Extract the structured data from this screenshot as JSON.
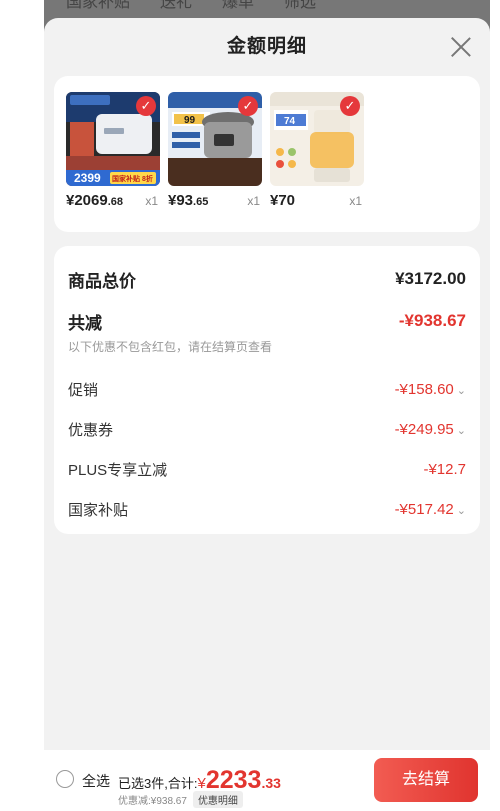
{
  "background": {
    "tabs": [
      "国家补贴",
      "送礼",
      "爆单",
      "筛选"
    ]
  },
  "sheet": {
    "title": "金额明细",
    "close_icon": "close-icon"
  },
  "products": [
    {
      "name": "water-heater",
      "price_int": "¥2069",
      "price_dec": ".68",
      "qty": "x1",
      "thumb_text": "2399",
      "thumb_tag": "国家补贴 8折",
      "colors": [
        "#1d3b6e",
        "#e9503c"
      ]
    },
    {
      "name": "electric-pressure-cooker",
      "price_int": "¥93",
      "price_dec": ".65",
      "qty": "x1",
      "thumb_text": "99",
      "thumb_tag": "",
      "colors": [
        "#2f5fa8",
        "#f2c24a"
      ]
    },
    {
      "name": "food-processor",
      "price_int": "¥70",
      "price_dec": "",
      "qty": "x1",
      "thumb_text": "74",
      "thumb_tag": "",
      "colors": [
        "#4d7bd4",
        "#f5b84a"
      ]
    }
  ],
  "summary": {
    "total_label": "商品总价",
    "total_value": "¥3172.00",
    "discount_label": "共减",
    "discount_value": "-¥938.67",
    "hint": "以下优惠不包含红包，请在结算页查看",
    "items": [
      {
        "label": "促销",
        "value": "-¥158.60",
        "chevron": true
      },
      {
        "label": "优惠券",
        "value": "-¥249.95",
        "chevron": true
      },
      {
        "label": "PLUS专享立减",
        "value": "-¥12.7",
        "chevron": false
      },
      {
        "label": "国家补贴",
        "value": "-¥517.42",
        "chevron": true
      }
    ]
  },
  "bottom": {
    "select_all": "全选",
    "selected_info": "已选3件,合计:",
    "total_currency": "¥",
    "total_int": "2233",
    "total_dec": ".33",
    "discount_text": "优惠减:¥938.67",
    "detail_button": "优惠明细",
    "checkout_button": "去结算"
  },
  "colors": {
    "accent": "#e2352f",
    "sheet_bg": "#f2f2f2"
  }
}
